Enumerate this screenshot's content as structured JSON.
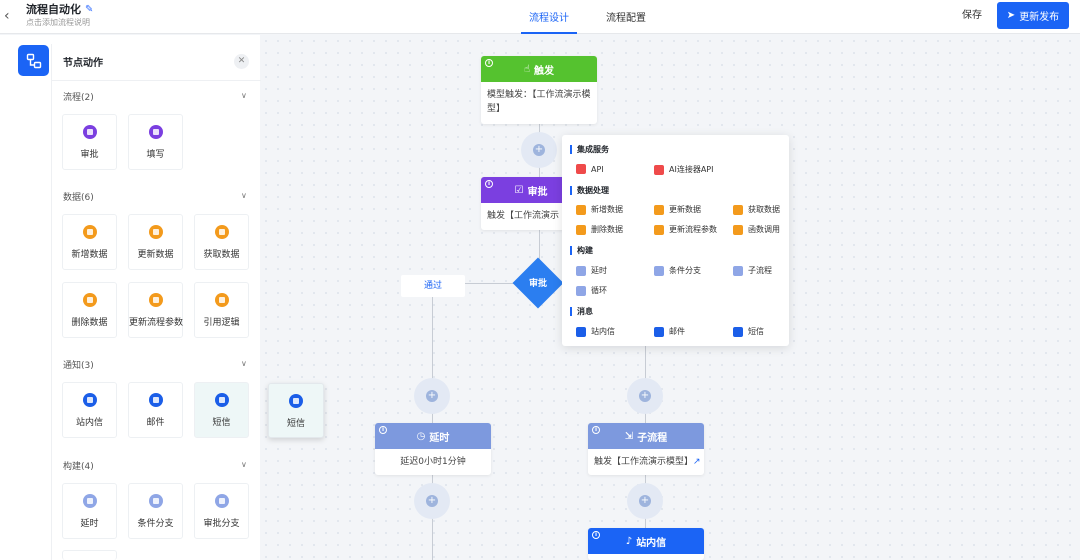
{
  "header": {
    "title": "流程自动化",
    "subtitle": "点击添加流程说明",
    "tabs": [
      {
        "label": "流程设计",
        "active": true
      },
      {
        "label": "流程配置",
        "active": false
      }
    ],
    "save_label": "保存",
    "publish_label": "更新发布"
  },
  "panel": {
    "title": "节点动作",
    "sections": [
      {
        "label": "流程(2)",
        "items": [
          "审批",
          "填写"
        ]
      },
      {
        "label": "数据(6)",
        "items": [
          "新增数据",
          "更新数据",
          "获取数据",
          "删除数据",
          "更新流程参数",
          "引用逻辑"
        ]
      },
      {
        "label": "通知(3)",
        "items": [
          "站内信",
          "邮件",
          "短信"
        ]
      },
      {
        "label": "构建(4)",
        "items": [
          "延时",
          "条件分支",
          "审批分支"
        ]
      }
    ],
    "dragging_label": "短信"
  },
  "flow": {
    "trigger": {
      "title": "触发",
      "body": "模型触发：【工作流演示模型】",
      "color": "#55c22f"
    },
    "approve": {
      "title": "审批",
      "body": "触发【工作流演示",
      "color": "#7b3fe0"
    },
    "decision": {
      "label": "审批"
    },
    "pass_label": "通过",
    "delay": {
      "title": "延时",
      "body": "延迟0小时1分钟",
      "color": "#7d99de"
    },
    "subflow": {
      "title": "子流程",
      "body": "触发【工作流演示模型】",
      "color": "#7d99de"
    },
    "inbox": {
      "title": "站内信",
      "color": "#1b64f5"
    }
  },
  "menu": {
    "groups": [
      {
        "label": "集成服务",
        "items": [
          "API",
          "AI连接器API"
        ]
      },
      {
        "label": "数据处理",
        "items": [
          "新增数据",
          "更新数据",
          "获取数据",
          "删除数据",
          "更新流程参数",
          "函数调用"
        ]
      },
      {
        "label": "构建",
        "items": [
          "延时",
          "条件分支",
          "子流程",
          "循环"
        ]
      },
      {
        "label": "消息",
        "items": [
          "站内信",
          "邮件",
          "短信"
        ]
      }
    ]
  },
  "colors": {
    "accent": "#1b64f5",
    "trigger": "#55c22f",
    "approve": "#7b3fe0",
    "data": "#f39a1c"
  }
}
